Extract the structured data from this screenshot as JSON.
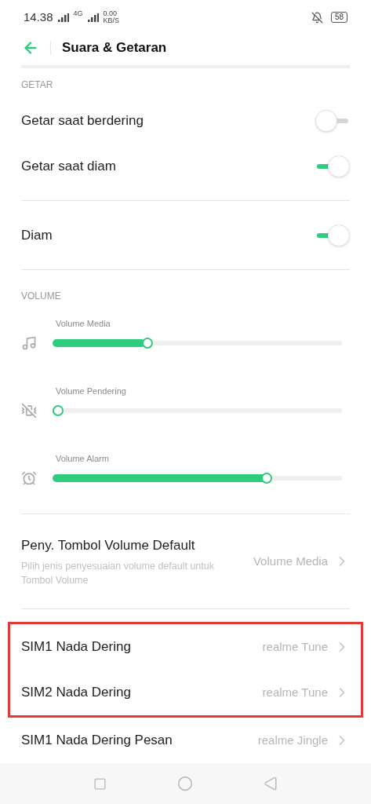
{
  "status_bar": {
    "time": "14.38",
    "network": "4G",
    "speed": "0.00",
    "speed_unit": "KB/S",
    "battery": "58"
  },
  "header": {
    "title": "Suara & Getaran"
  },
  "vibrate": {
    "heading": "GETAR",
    "toggles": [
      {
        "label": "Getar saat berdering",
        "on": false
      },
      {
        "label": "Getar saat diam",
        "on": true
      }
    ]
  },
  "silent": {
    "label": "Diam",
    "on": true
  },
  "volume": {
    "heading": "VOLUME",
    "sliders": [
      {
        "label": "Volume Media",
        "kind": "music",
        "level": 0.32
      },
      {
        "label": "Volume Pendering",
        "kind": "vibrate-off",
        "level": 0
      },
      {
        "label": "Volume Alarm",
        "kind": "alarm",
        "level": 0.75
      }
    ]
  },
  "default_volume": {
    "title": "Peny. Tombol Volume Default",
    "description": "Pilih jenis penyesuaian volume default untuk Tombol Volume",
    "value": "Volume Media"
  },
  "ringtones": [
    {
      "label": "SIM1 Nada Dering",
      "value": "realme Tune",
      "highlighted": true
    },
    {
      "label": "SIM2 Nada Dering",
      "value": "realme Tune",
      "highlighted": true
    },
    {
      "label": "SIM1 Nada Dering Pesan",
      "value": "realme Jingle",
      "highlighted": false
    }
  ]
}
